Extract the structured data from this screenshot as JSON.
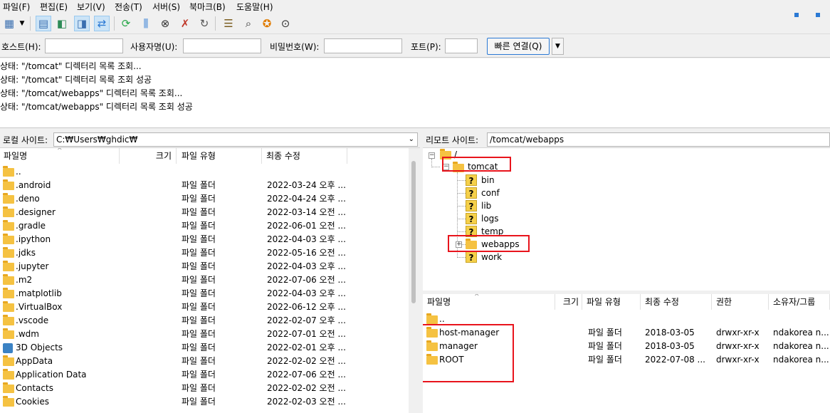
{
  "menu": [
    "파일(F)",
    "편집(E)",
    "보기(V)",
    "전송(T)",
    "서버(S)",
    "북마크(B)",
    "도움말(H)"
  ],
  "quickconnect": {
    "host_label": "호스트(H):",
    "user_label": "사용자명(U):",
    "pass_label": "비밀번호(W):",
    "port_label": "포트(P):",
    "host_value": "",
    "user_value": "",
    "pass_value": "",
    "port_value": "",
    "connect_label": "빠른 연결(Q)",
    "dropdown_arrow": "▼"
  },
  "log": [
    "상태: \"/tomcat\" 디렉터리 목록 조회...",
    "상태: \"/tomcat\" 디렉터리 목록 조회 성공",
    "상태: \"/tomcat/webapps\" 디렉터리 목록 조회...",
    "상태: \"/tomcat/webapps\" 디렉터리 목록 조회 성공"
  ],
  "local": {
    "site_label": "로컬 사이트:",
    "path": "C:₩Users₩ghdic₩",
    "columns": [
      "파일명",
      "크기",
      "파일 유형",
      "최종 수정"
    ],
    "rows": [
      {
        "name": "..",
        "type": "",
        "modified": "",
        "icon": "folder-icon"
      },
      {
        "name": ".android",
        "type": "파일 폴더",
        "modified": "2022-03-24 오후 ...",
        "icon": "folder-icon"
      },
      {
        "name": ".deno",
        "type": "파일 폴더",
        "modified": "2022-04-24 오후 ...",
        "icon": "folder-icon"
      },
      {
        "name": ".designer",
        "type": "파일 폴더",
        "modified": "2022-03-14 오전 ...",
        "icon": "folder-icon"
      },
      {
        "name": ".gradle",
        "type": "파일 폴더",
        "modified": "2022-06-01 오전 ...",
        "icon": "folder-icon"
      },
      {
        "name": ".ipython",
        "type": "파일 폴더",
        "modified": "2022-04-03 오후 ...",
        "icon": "folder-icon"
      },
      {
        "name": ".jdks",
        "type": "파일 폴더",
        "modified": "2022-05-16 오전 ...",
        "icon": "folder-icon"
      },
      {
        "name": ".jupyter",
        "type": "파일 폴더",
        "modified": "2022-04-03 오후 ...",
        "icon": "folder-icon"
      },
      {
        "name": ".m2",
        "type": "파일 폴더",
        "modified": "2022-07-06 오전 ...",
        "icon": "folder-icon"
      },
      {
        "name": ".matplotlib",
        "type": "파일 폴더",
        "modified": "2022-04-03 오후 ...",
        "icon": "folder-icon"
      },
      {
        "name": ".VirtualBox",
        "type": "파일 폴더",
        "modified": "2022-06-12 오후 ...",
        "icon": "folder-icon"
      },
      {
        "name": ".vscode",
        "type": "파일 폴더",
        "modified": "2022-02-07 오후 ...",
        "icon": "folder-icon"
      },
      {
        "name": ".wdm",
        "type": "파일 폴더",
        "modified": "2022-07-01 오전 ...",
        "icon": "folder-icon"
      },
      {
        "name": "3D Objects",
        "type": "파일 폴더",
        "modified": "2022-02-01 오후 ...",
        "icon": "3d-objects-icon"
      },
      {
        "name": "AppData",
        "type": "파일 폴더",
        "modified": "2022-02-02 오전 ...",
        "icon": "folder-icon"
      },
      {
        "name": "Application Data",
        "type": "파일 폴더",
        "modified": "2022-07-06 오전 ...",
        "icon": "folder-icon"
      },
      {
        "name": "Contacts",
        "type": "파일 폴더",
        "modified": "2022-02-02 오전 ...",
        "icon": "folder-icon"
      },
      {
        "name": "Cookies",
        "type": "파일 폴더",
        "modified": "2022-02-03 오전 ...",
        "icon": "folder-icon"
      }
    ]
  },
  "remote": {
    "site_label": "리모트 사이트:",
    "path": "/tomcat/webapps",
    "tree": {
      "root": "/",
      "tomcat": "tomcat",
      "children": [
        "bin",
        "conf",
        "lib",
        "logs",
        "temp",
        "webapps",
        "work"
      ]
    },
    "columns": [
      "파일명",
      "크기",
      "파일 유형",
      "최종 수정",
      "권한",
      "소유자/그룹"
    ],
    "rows": [
      {
        "name": "..",
        "type": "",
        "modified": "",
        "perm": "",
        "owner": ""
      },
      {
        "name": "host-manager",
        "type": "파일 폴더",
        "modified": "2018-03-05",
        "perm": "drwxr-xr-x",
        "owner": "ndakorea n..."
      },
      {
        "name": "manager",
        "type": "파일 폴더",
        "modified": "2018-03-05",
        "perm": "drwxr-xr-x",
        "owner": "ndakorea n..."
      },
      {
        "name": "ROOT",
        "type": "파일 폴더",
        "modified": "2022-07-08 ...",
        "perm": "drwxr-xr-x",
        "owner": "ndakorea n..."
      }
    ]
  },
  "colors": {
    "highlight": "#e8141c",
    "folder": "#f5c242",
    "accent": "#2b79d4"
  }
}
